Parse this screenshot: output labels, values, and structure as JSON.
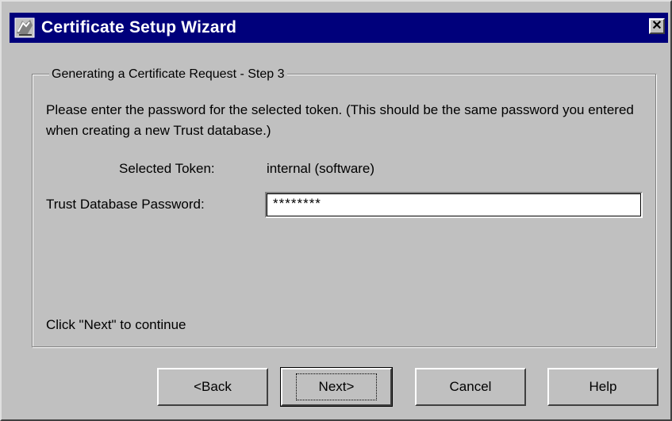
{
  "window": {
    "title": "Certificate Setup Wizard",
    "close_symbol": "✕",
    "icon": "certificate-app-icon"
  },
  "step": {
    "legend": "Generating a Certificate Request - Step 3",
    "description": "Please enter the password for the selected token. (This should be the same password you entered when creating a new Trust database.)",
    "token_label": "Selected Token:",
    "token_value": "internal (software)",
    "password_label": "Trust Database Password:",
    "password_value": "********",
    "hint": "Click \"Next\" to continue"
  },
  "buttons": {
    "back": "<Back",
    "next": "Next>",
    "cancel": "Cancel",
    "help": "Help"
  },
  "colors": {
    "titlebar": "#00007b",
    "face": "#c0c0c0"
  }
}
